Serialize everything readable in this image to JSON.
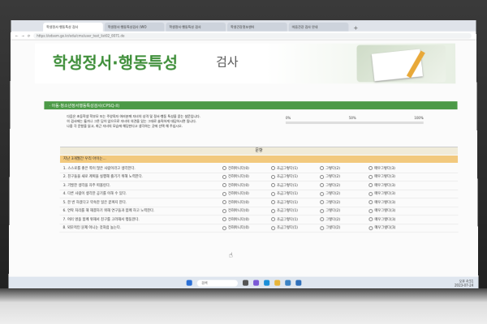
{
  "browser": {
    "tabs": [
      "학생정서·행동특성 검사",
      "학생정서·행동특성검사 (WO",
      "학생정서·행동특성 검사",
      "학생건강정보센터",
      "마음건강 검사 안내"
    ],
    "url": "https://edsem.go.kr/edu/cms/user_test_list02_0071.do"
  },
  "page": {
    "title_main": "학생정서·행동특성",
    "title_sub": "검사",
    "section_bar": "· 아동·청소년정서행동특성검사(CPSQ-II)",
    "intro_lines": [
      "다음은 초등학생 학부모 또는 주양육자 여러분께 자녀의 성격 및 정서·행동 특성을 묻는 설문입니다.",
      "이 검사에는 옳거나 그른 답이 없으므로 자녀의 의견을 있는 그대로 솔직하게 대답하시면 됩니다.",
      "나중 각 문항을 읽고, 최근 자녀의 모습에 해당한다고 생각하는 곳에 선택 해 주십시오."
    ],
    "progress_labels": [
      "0%",
      "50%",
      "100%"
    ],
    "group_header": "문항",
    "subheader": "지난 3개월간 우리 아이는..."
  },
  "options": [
    "전혀아니다(0)",
    "조금그렇다(1)",
    "그렇다(2)",
    "매우그렇다(3)"
  ],
  "questions": [
    "1. 스스로를 좋은 쪽이 많은 사람이라고 생각한다.",
    "2. 친구들을 새로 계획을 실행해 즐기기 위해 노력한다.",
    "3. 기발한 생각을 자주 떠올린다.",
    "4. 다른 사람이 생각한 공기를 이해 수 있다.",
    "5. 한 번 하겠다고 약속한 일은 끝까지 한다.",
    "6. 연락 처리를 해 해결하기 위해 연구들과 함께 하고 노력한다.",
    "7. 여러 명을 함께 위해서 친구를 고려해서 행동한다.",
    "8. 외모적인 문제 아니는 것처럼 놀는다."
  ],
  "taskbar": {
    "search_label": "검색",
    "time": "오후 4:51",
    "date": "2023-07-24"
  }
}
